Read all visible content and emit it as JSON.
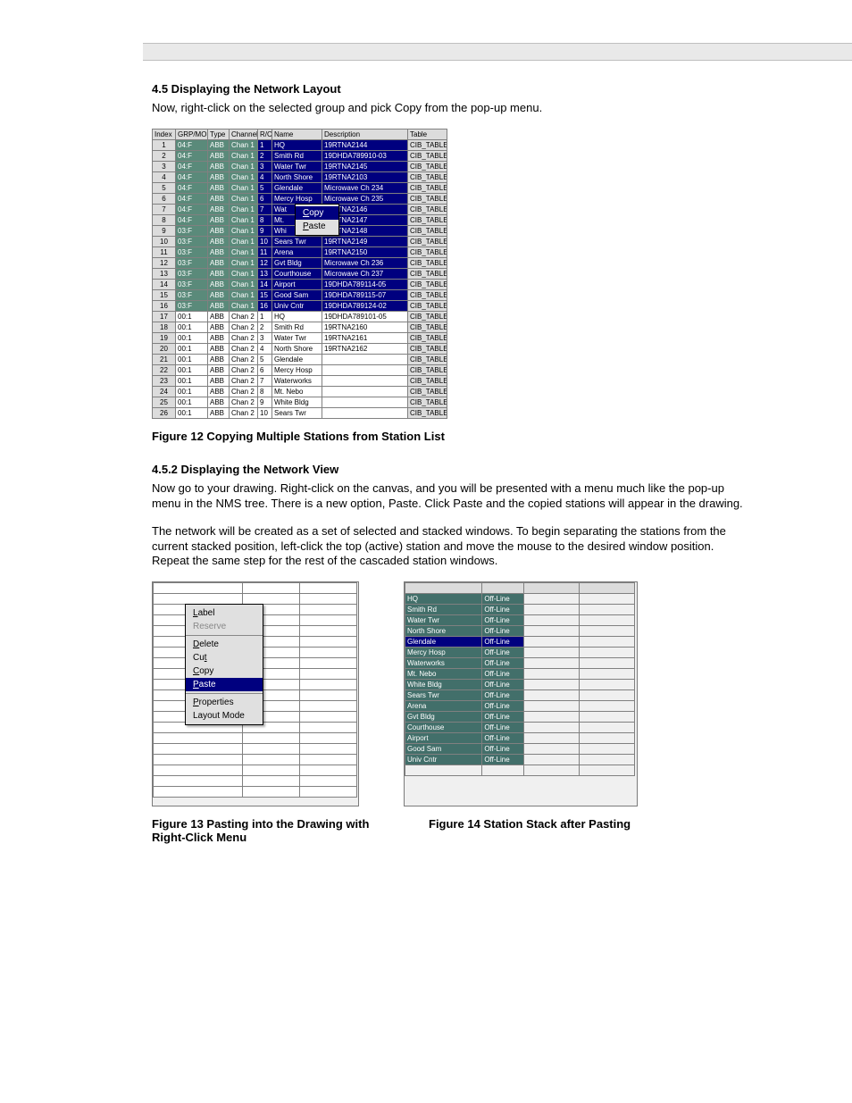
{
  "header_bar": "",
  "sec1_title": "4.5  Displaying the Network Layout",
  "sec1_list_intro": "Now, right-click on the selected group and pick Copy from the pop-up menu.",
  "sec2_title": "4.5.2  Displaying the Network View",
  "sec2_para1": "Now go to your drawing.  Right-click on the canvas, and you will be presented with a menu much like the pop-up menu in the NMS tree.  There is a new option, Paste.  Click Paste and the copied stations will appear in the drawing.",
  "sec2_para2": "The network will be created as a set of selected and stacked windows.  To begin separating the stations from the current stacked position, left-click the top (active) station and move the mouse to the desired window position.  Repeat the same step for the rest of the cascaded station windows.",
  "fig1_caption": "Figure 12  Copying Multiple Stations from Station List",
  "fig2_left_caption": "Figure 13  Pasting into the Drawing with Right-Click Menu",
  "fig2_right_caption": "Figure 14  Station Stack after Pasting",
  "table_headers": [
    "Index",
    "GRP/MOD",
    "Type",
    "Channel",
    "R/C",
    "Name",
    "Description",
    "Table"
  ],
  "table_rows": [
    {
      "idx": "1",
      "gm": "04:F",
      "type": "ABB",
      "ch": "Chan 1",
      "rc": "1",
      "name": "HQ",
      "desc": "19RTNA2144",
      "tbl": "CIB_TABLE",
      "sel": 1
    },
    {
      "idx": "2",
      "gm": "04:F",
      "type": "ABB",
      "ch": "Chan 1",
      "rc": "2",
      "name": "Smith Rd",
      "desc": "19DHDA789910-03",
      "tbl": "CIB_TABLE",
      "sel": 1
    },
    {
      "idx": "3",
      "gm": "04:F",
      "type": "ABB",
      "ch": "Chan 1",
      "rc": "3",
      "name": "Water Twr",
      "desc": "19RTNA2145",
      "tbl": "CIB_TABLE",
      "sel": 1
    },
    {
      "idx": "4",
      "gm": "04:F",
      "type": "ABB",
      "ch": "Chan 1",
      "rc": "4",
      "name": "North Shore",
      "desc": "19RTNA2103",
      "tbl": "CIB_TABLE",
      "sel": 1
    },
    {
      "idx": "5",
      "gm": "04:F",
      "type": "ABB",
      "ch": "Chan 1",
      "rc": "5",
      "name": "Glendale",
      "desc": "Microwave Ch 234",
      "tbl": "CIB_TABLE",
      "sel": 1
    },
    {
      "idx": "6",
      "gm": "04:F",
      "type": "ABB",
      "ch": "Chan 1",
      "rc": "6",
      "name": "Mercy Hosp",
      "desc": "Microwave Ch 235",
      "tbl": "CIB_TABLE",
      "sel": 1
    },
    {
      "idx": "7",
      "gm": "04:F",
      "type": "ABB",
      "ch": "Chan 1",
      "rc": "7",
      "name": "Wat",
      "desc": "19RTNA2146",
      "tbl": "CIB_TABLE",
      "sel": 1,
      "menu": "Copy"
    },
    {
      "idx": "8",
      "gm": "04:F",
      "type": "ABB",
      "ch": "Chan 1",
      "rc": "8",
      "name": "Mt.",
      "desc": "19RTNA2147",
      "tbl": "CIB_TABLE",
      "sel": 1,
      "menu": "Paste"
    },
    {
      "idx": "9",
      "gm": "03:F",
      "type": "ABB",
      "ch": "Chan 1",
      "rc": "9",
      "name": "Whi",
      "desc": "19RTNA2148",
      "tbl": "CIB_TABLE",
      "sel": 1
    },
    {
      "idx": "10",
      "gm": "03:F",
      "type": "ABB",
      "ch": "Chan 1",
      "rc": "10",
      "name": "Sears Twr",
      "desc": "19RTNA2149",
      "tbl": "CIB_TABLE",
      "sel": 1
    },
    {
      "idx": "11",
      "gm": "03:F",
      "type": "ABB",
      "ch": "Chan 1",
      "rc": "11",
      "name": "Arena",
      "desc": "19RTNA2150",
      "tbl": "CIB_TABLE",
      "sel": 1
    },
    {
      "idx": "12",
      "gm": "03:F",
      "type": "ABB",
      "ch": "Chan 1",
      "rc": "12",
      "name": "Gvt Bldg",
      "desc": "Microwave Ch 236",
      "tbl": "CIB_TABLE",
      "sel": 1
    },
    {
      "idx": "13",
      "gm": "03:F",
      "type": "ABB",
      "ch": "Chan 1",
      "rc": "13",
      "name": "Courthouse",
      "desc": "Microwave Ch 237",
      "tbl": "CIB_TABLE",
      "sel": 1
    },
    {
      "idx": "14",
      "gm": "03:F",
      "type": "ABB",
      "ch": "Chan 1",
      "rc": "14",
      "name": "Airport",
      "desc": "19DHDA789114-05",
      "tbl": "CIB_TABLE",
      "sel": 1
    },
    {
      "idx": "15",
      "gm": "03:F",
      "type": "ABB",
      "ch": "Chan 1",
      "rc": "15",
      "name": "Good Sam",
      "desc": "19DHDA789115-07",
      "tbl": "CIB_TABLE",
      "sel": 1
    },
    {
      "idx": "16",
      "gm": "03:F",
      "type": "ABB",
      "ch": "Chan 1",
      "rc": "16",
      "name": "Univ Cntr",
      "desc": "19DHDA789124-02",
      "tbl": "CIB_TABLE",
      "sel": 1
    },
    {
      "idx": "17",
      "gm": "00:1",
      "type": "ABB",
      "ch": "Chan 2",
      "rc": "1",
      "name": "HQ",
      "desc": "19DHDA789101-05",
      "tbl": "CIB_TABLE",
      "sel": 0
    },
    {
      "idx": "18",
      "gm": "00:1",
      "type": "ABB",
      "ch": "Chan 2",
      "rc": "2",
      "name": "Smith Rd",
      "desc": "19RTNA2160",
      "tbl": "CIB_TABLE",
      "sel": 0
    },
    {
      "idx": "19",
      "gm": "00:1",
      "type": "ABB",
      "ch": "Chan 2",
      "rc": "3",
      "name": "Water Twr",
      "desc": "19RTNA2161",
      "tbl": "CIB_TABLE",
      "sel": 0
    },
    {
      "idx": "20",
      "gm": "00:1",
      "type": "ABB",
      "ch": "Chan 2",
      "rc": "4",
      "name": "North Shore",
      "desc": "19RTNA2162",
      "tbl": "CIB_TABLE",
      "sel": 0
    },
    {
      "idx": "21",
      "gm": "00:1",
      "type": "ABB",
      "ch": "Chan 2",
      "rc": "5",
      "name": "Glendale",
      "desc": "",
      "tbl": "CIB_TABLE",
      "sel": 0
    },
    {
      "idx": "22",
      "gm": "00:1",
      "type": "ABB",
      "ch": "Chan 2",
      "rc": "6",
      "name": "Mercy Hosp",
      "desc": "",
      "tbl": "CIB_TABLE",
      "sel": 0
    },
    {
      "idx": "23",
      "gm": "00:1",
      "type": "ABB",
      "ch": "Chan 2",
      "rc": "7",
      "name": "Waterworks",
      "desc": "",
      "tbl": "CIB_TABLE",
      "sel": 0
    },
    {
      "idx": "24",
      "gm": "00:1",
      "type": "ABB",
      "ch": "Chan 2",
      "rc": "8",
      "name": "Mt. Nebo",
      "desc": "",
      "tbl": "CIB_TABLE",
      "sel": 0
    },
    {
      "idx": "25",
      "gm": "00:1",
      "type": "ABB",
      "ch": "Chan 2",
      "rc": "9",
      "name": "White Bldg",
      "desc": "",
      "tbl": "CIB_TABLE",
      "sel": 0
    },
    {
      "idx": "26",
      "gm": "00:1",
      "type": "ABB",
      "ch": "Chan 2",
      "rc": "10",
      "name": "Sears Twr",
      "desc": "",
      "tbl": "CIB_TABLE",
      "sel": 0
    }
  ],
  "ctx_small": {
    "copy": "Copy",
    "paste": "Paste"
  },
  "ctx_menu2": [
    {
      "t": "Label",
      "u": 1
    },
    {
      "t": "Reserve",
      "dis": 1
    },
    {
      "t": "-"
    },
    {
      "t": "Delete",
      "u": 1
    },
    {
      "t": "Cut",
      "u": 2
    },
    {
      "t": "Copy",
      "u": 1
    },
    {
      "t": "Paste",
      "u": 1,
      "hl": 1
    },
    {
      "t": "-"
    },
    {
      "t": "Properties",
      "u": 1
    },
    {
      "t": "Layout Mode"
    }
  ],
  "stack_rows": [
    {
      "n": "HQ",
      "s": "Off-Line"
    },
    {
      "n": "Smith Rd",
      "s": "Off-Line"
    },
    {
      "n": "Water Twr",
      "s": "Off-Line"
    },
    {
      "n": "North Shore",
      "s": "Off-Line"
    },
    {
      "n": "Glendale",
      "s": "Off-Line",
      "sel": 1
    },
    {
      "n": "Mercy Hosp",
      "s": "Off-Line"
    },
    {
      "n": "Waterworks",
      "s": "Off-Line"
    },
    {
      "n": "Mt. Nebo",
      "s": "Off-Line"
    },
    {
      "n": "White Bldg",
      "s": "Off-Line"
    },
    {
      "n": "Sears Twr",
      "s": "Off-Line"
    },
    {
      "n": "Arena",
      "s": "Off-Line"
    },
    {
      "n": "Gvt Bldg",
      "s": "Off-Line"
    },
    {
      "n": "Courthouse",
      "s": "Off-Line"
    },
    {
      "n": "Airport",
      "s": "Off-Line"
    },
    {
      "n": "Good Sam",
      "s": "Off-Line"
    },
    {
      "n": "Univ Cntr",
      "s": "Off-Line"
    }
  ]
}
